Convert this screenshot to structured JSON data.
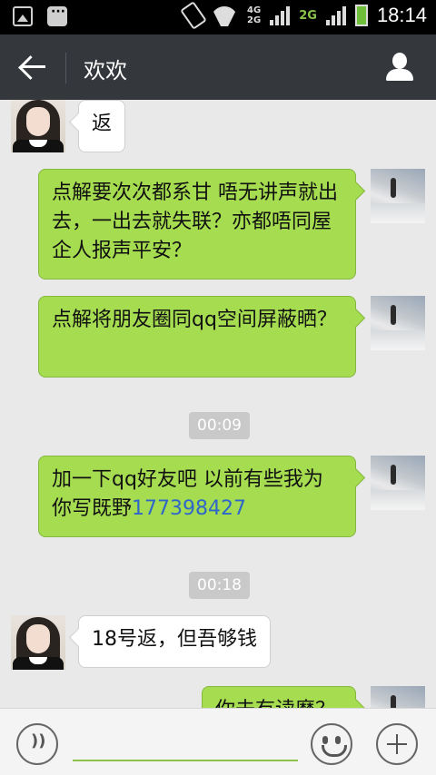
{
  "status_bar": {
    "network_4g": "4G",
    "network_2g_small": "2G",
    "network_2g": "2G",
    "time": "18:14",
    "icons": [
      "image-icon",
      "chat-icon",
      "rotate-icon",
      "wifi-icon",
      "signal-icon",
      "battery-icon"
    ]
  },
  "header": {
    "title": "欢欢",
    "back_icon": "back-arrow-icon",
    "profile_icon": "profile-icon"
  },
  "messages": [
    {
      "from": "contact",
      "text": "返"
    },
    {
      "from": "me",
      "text": "点解要次次都系甘 唔无讲声就出去，一出去就失联？亦都唔同屋企人报声平安？"
    },
    {
      "from": "me",
      "text": "点解将朋友圈同qq空间屏蔽晒？"
    },
    {
      "type": "time",
      "text": "00:09"
    },
    {
      "from": "me",
      "text": "加一下qq好友吧 以前有些我为你写既野",
      "link": "177398427"
    },
    {
      "type": "time",
      "text": "00:18"
    },
    {
      "from": "contact",
      "text": "18号返，但吾够钱"
    },
    {
      "from": "me",
      "text": "你未有读麽？"
    }
  ],
  "input_bar": {
    "voice_icon": "voice-icon",
    "emoji_icon": "emoji-icon",
    "plus_icon": "plus-icon",
    "input_value": ""
  },
  "colors": {
    "header_bg": "#34373c",
    "outgoing_bubble": "#a5dc50",
    "incoming_bubble": "#ffffff",
    "link": "#2f66c9"
  }
}
